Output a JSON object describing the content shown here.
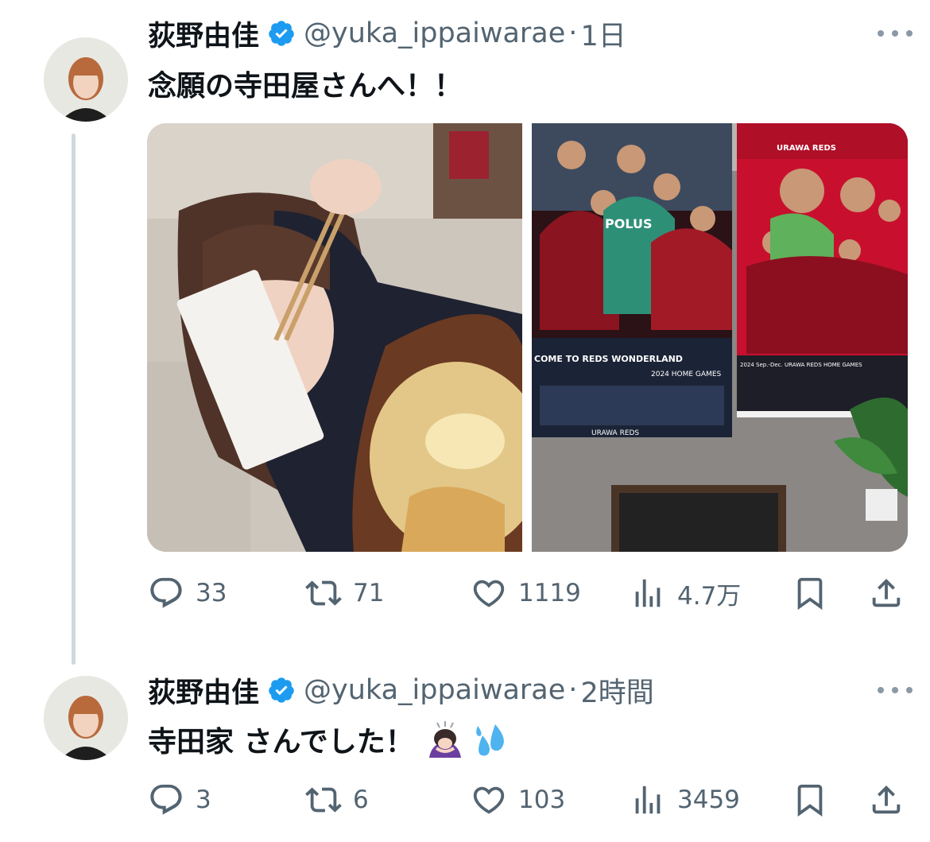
{
  "thread": {
    "tweets": [
      {
        "author_name": "荻野由佳",
        "handle": "@yuka_ippaiwarae",
        "separator": "·",
        "time": "1日",
        "text": "念願の寺田屋さんへ！！",
        "media": [
          {
            "icon": "photo-selfie-chopsticks"
          },
          {
            "icon": "photo-urawa-reds-posters",
            "poster_texts": [
              "URAWA REDS",
              "COME TO REDS WONDERLAND",
              "2024 HOME GAMES",
              "POLUS",
              "URAWA REDS",
              "2024 Sep.-Dec. URAWA REDS HOME GAMES"
            ]
          }
        ],
        "stats": {
          "replies": "33",
          "reposts": "71",
          "likes": "1119",
          "views": "4.7万"
        }
      },
      {
        "author_name": "荻野由佳",
        "handle": "@yuka_ippaiwarae",
        "separator": "·",
        "time": "2時間",
        "text": "寺田家 さんでした！",
        "emojis": [
          "person-bowing-emoji",
          "sweat-droplets-emoji"
        ],
        "stats": {
          "replies": "3",
          "reposts": "6",
          "likes": "103",
          "views": "3459"
        }
      }
    ]
  },
  "colors": {
    "text_primary": "#0f1419",
    "text_secondary": "#536471",
    "verified_blue": "#1d9bf0",
    "thread_line": "#cfd9de",
    "reds_red": "#c8102e"
  }
}
